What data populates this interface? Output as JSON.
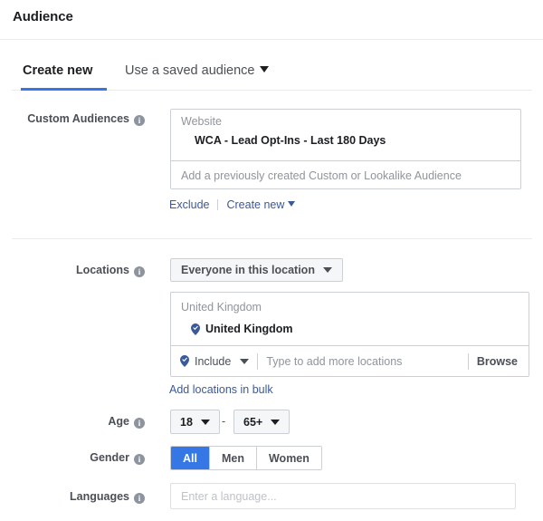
{
  "header": {
    "title": "Audience"
  },
  "tabs": [
    {
      "label": "Create new",
      "active": true
    },
    {
      "label": "Use a saved audience",
      "active": false
    }
  ],
  "custom_audiences": {
    "label": "Custom Audiences",
    "group_header": "Website",
    "selected_audience": "WCA - Lead Opt-Ins - Last 180 Days",
    "placeholder": "Add a previously created Custom or Lookalike Audience",
    "exclude_link": "Exclude",
    "create_new_link": "Create new"
  },
  "locations": {
    "label": "Locations",
    "scope_value": "Everyone in this location",
    "group_header": "United Kingdom",
    "selected_location": "United Kingdom",
    "include_value": "Include",
    "search_placeholder": "Type to add more locations",
    "browse_label": "Browse",
    "bulk_link": "Add locations in bulk"
  },
  "age": {
    "label": "Age",
    "min": "18",
    "max": "65+",
    "separator": "-"
  },
  "gender": {
    "label": "Gender",
    "options": [
      {
        "label": "All",
        "selected": true
      },
      {
        "label": "Men",
        "selected": false
      },
      {
        "label": "Women",
        "selected": false
      }
    ]
  },
  "languages": {
    "label": "Languages",
    "placeholder": "Enter a language..."
  },
  "icons": {
    "info": "info-icon",
    "caret": "chevron-down-icon",
    "pin": "map-pin-check-icon"
  },
  "colors": {
    "accent_blue": "#3578e5",
    "link_blue": "#3b5998",
    "pin_blue": "#3b5a9a",
    "border": "#ccd0d5",
    "text_dark": "#1c1e21",
    "text_muted": "#90949c"
  }
}
